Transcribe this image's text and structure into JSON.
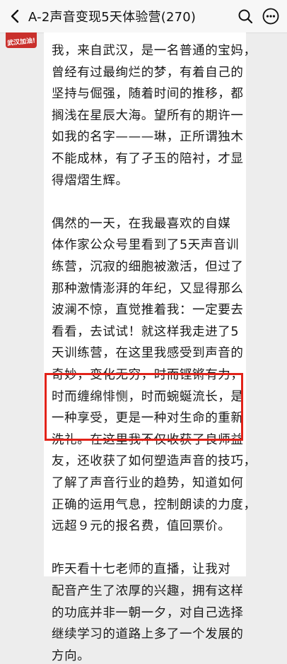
{
  "header": {
    "title": "A-2声音变现5天体验营(270)",
    "back_icon": "chevron-left-icon",
    "search_icon": "search-icon",
    "more_icon": "more-dots-icon"
  },
  "avatar": {
    "label": "武汉加油!"
  },
  "message": {
    "lines": [
      "我，来自武汉，是一名普通的宝妈，",
      "曾经有过最绚烂的梦，有着自己的",
      "坚持与倔强，随着时间的推移，都",
      "搁浅在星辰大海。望所有的期许一",
      "如我的名字———琳，正所谓独木",
      "不能成林，有了孑玉的陪衬，才显",
      "得熠熠生辉。",
      "",
      "  偶然的一天，在我最喜欢的自媒",
      "体作家公众号里看到了5天声音训",
      "练营，沉寂的细胞被激活，但过了",
      "那种激情澎湃的年纪，又显得那么",
      "波澜不惊，直觉推着我：一定要去",
      "看看，去试试！就这样我走进了5",
      "天训练营，在这里我感受到声音的",
      "奇妙，变化无穷，时而铿锵有力，",
      "时而缠绵悱恻，时而蜿蜒流长，是",
      "一种享受，更是一种对生命的重新",
      "洗礼。在这里我不仅收获了良师益",
      "友，还收获了如何塑造声音的技巧，",
      "了解了声音行业的趋势，知道如何",
      "正确的运用气息，控制朗读的力度，",
      "远超９元的报名费，值回票价。",
      "",
      "  昨天看十七老师的直播，让我对",
      "配音产生了浓厚的兴趣，拥有这样",
      "的功底并非一朝一夕，对自己选择",
      "继续学习的道路上多了一个发展的",
      "方向。"
    ]
  },
  "colors": {
    "highlight_border": "#e2231a",
    "bubble": "#ffffff",
    "background": "#ededed"
  }
}
